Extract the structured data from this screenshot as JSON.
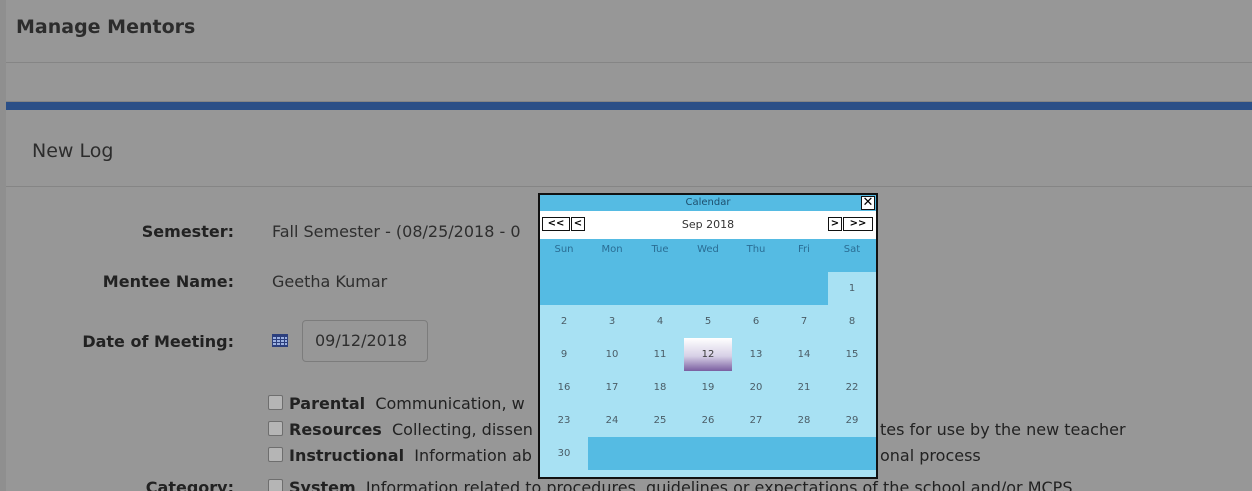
{
  "app": {
    "title": "Manage Mentors"
  },
  "section": {
    "title": "New Log"
  },
  "form": {
    "semester_label": "Semester:",
    "semester_value": "Fall Semester - (08/25/2018 - 0",
    "mentee_label": "Mentee Name:",
    "mentee_value": "Geetha Kumar",
    "date_label": "Date of Meeting:",
    "date_value": "09/12/2018",
    "category_label": "Category:"
  },
  "categories": [
    {
      "name": "Parental",
      "desc": "Communication, w"
    },
    {
      "name": "Resources",
      "desc": "Collecting, dissen",
      "desc_tail": "tes for use by the new teacher"
    },
    {
      "name": "Instructional",
      "desc": "Information ab",
      "desc_tail": "onal process"
    },
    {
      "name": "System",
      "desc": "Information related to procedures, guidelines or expectations of the school and/or MCPS"
    }
  ],
  "calendar": {
    "title": "Calendar",
    "close": "✕",
    "prev_year": "<<",
    "prev_month": "<",
    "next_month": ">",
    "next_year": ">>",
    "month": "Sep 2018",
    "weekdays": [
      "Sun",
      "Mon",
      "Tue",
      "Wed",
      "Thu",
      "Fri",
      "Sat"
    ],
    "weeks": [
      [
        "",
        "",
        "",
        "",
        "",
        "",
        "1"
      ],
      [
        "2",
        "3",
        "4",
        "5",
        "6",
        "7",
        "8"
      ],
      [
        "9",
        "10",
        "11",
        "12",
        "13",
        "14",
        "15"
      ],
      [
        "16",
        "17",
        "18",
        "19",
        "20",
        "21",
        "22"
      ],
      [
        "23",
        "24",
        "25",
        "26",
        "27",
        "28",
        "29"
      ],
      [
        "30",
        "",
        "",
        "",
        "",
        "",
        ""
      ]
    ],
    "selected": "12"
  }
}
